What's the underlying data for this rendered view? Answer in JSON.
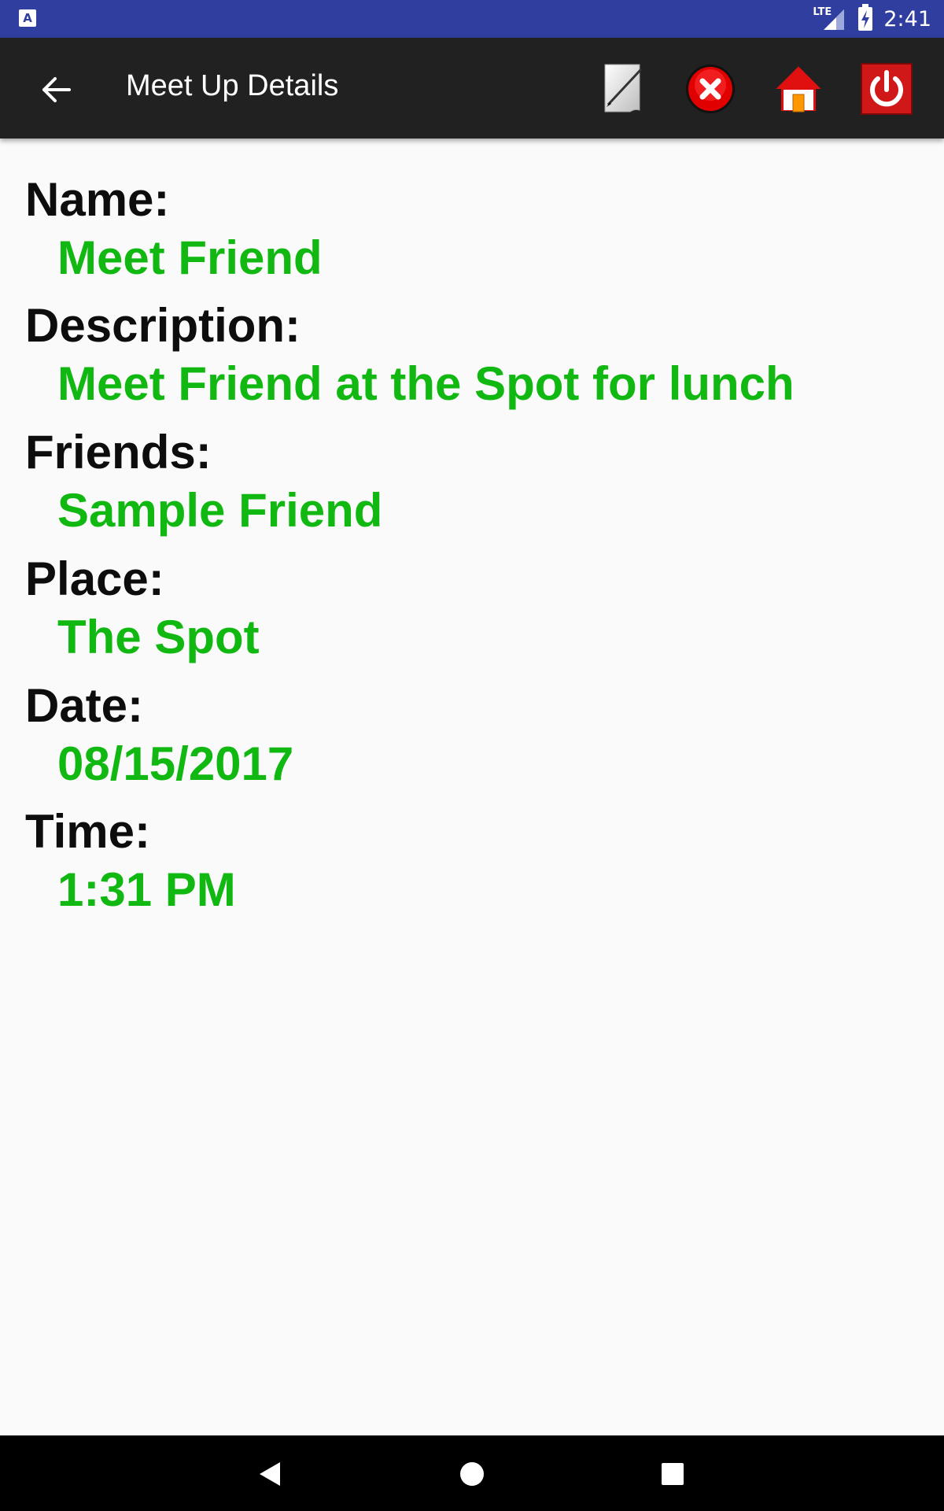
{
  "status_bar": {
    "time": "2:41",
    "network_label": "LTE",
    "app_icon_letter": "A",
    "icons": [
      "app-notification-icon",
      "lte-signal-icon",
      "battery-charging-icon"
    ],
    "background": "#303f9f"
  },
  "toolbar": {
    "title": "Meet Up Details",
    "background": "#212121",
    "actions": [
      {
        "name": "back",
        "icon": "arrow-left-icon"
      },
      {
        "name": "edit",
        "icon": "notepad-pencil-icon"
      },
      {
        "name": "delete",
        "icon": "red-close-icon"
      },
      {
        "name": "home",
        "icon": "house-icon"
      },
      {
        "name": "power",
        "icon": "power-icon"
      }
    ]
  },
  "details": {
    "name_label": "Name:",
    "name_value": "Meet Friend",
    "description_label": "Description:",
    "description_value": "Meet Friend at the Spot for lunch",
    "friends_label": "Friends:",
    "friends_value": "Sample Friend",
    "place_label": "Place:",
    "place_value": "The Spot",
    "date_label": "Date:",
    "date_value": "08/15/2017",
    "time_label": "Time:",
    "time_value": "1:31 PM",
    "label_color": "#0d0d0d",
    "value_color": "#12b812"
  },
  "nav_bar": {
    "buttons": [
      "nav-back-icon",
      "nav-home-icon",
      "nav-recents-icon"
    ]
  }
}
